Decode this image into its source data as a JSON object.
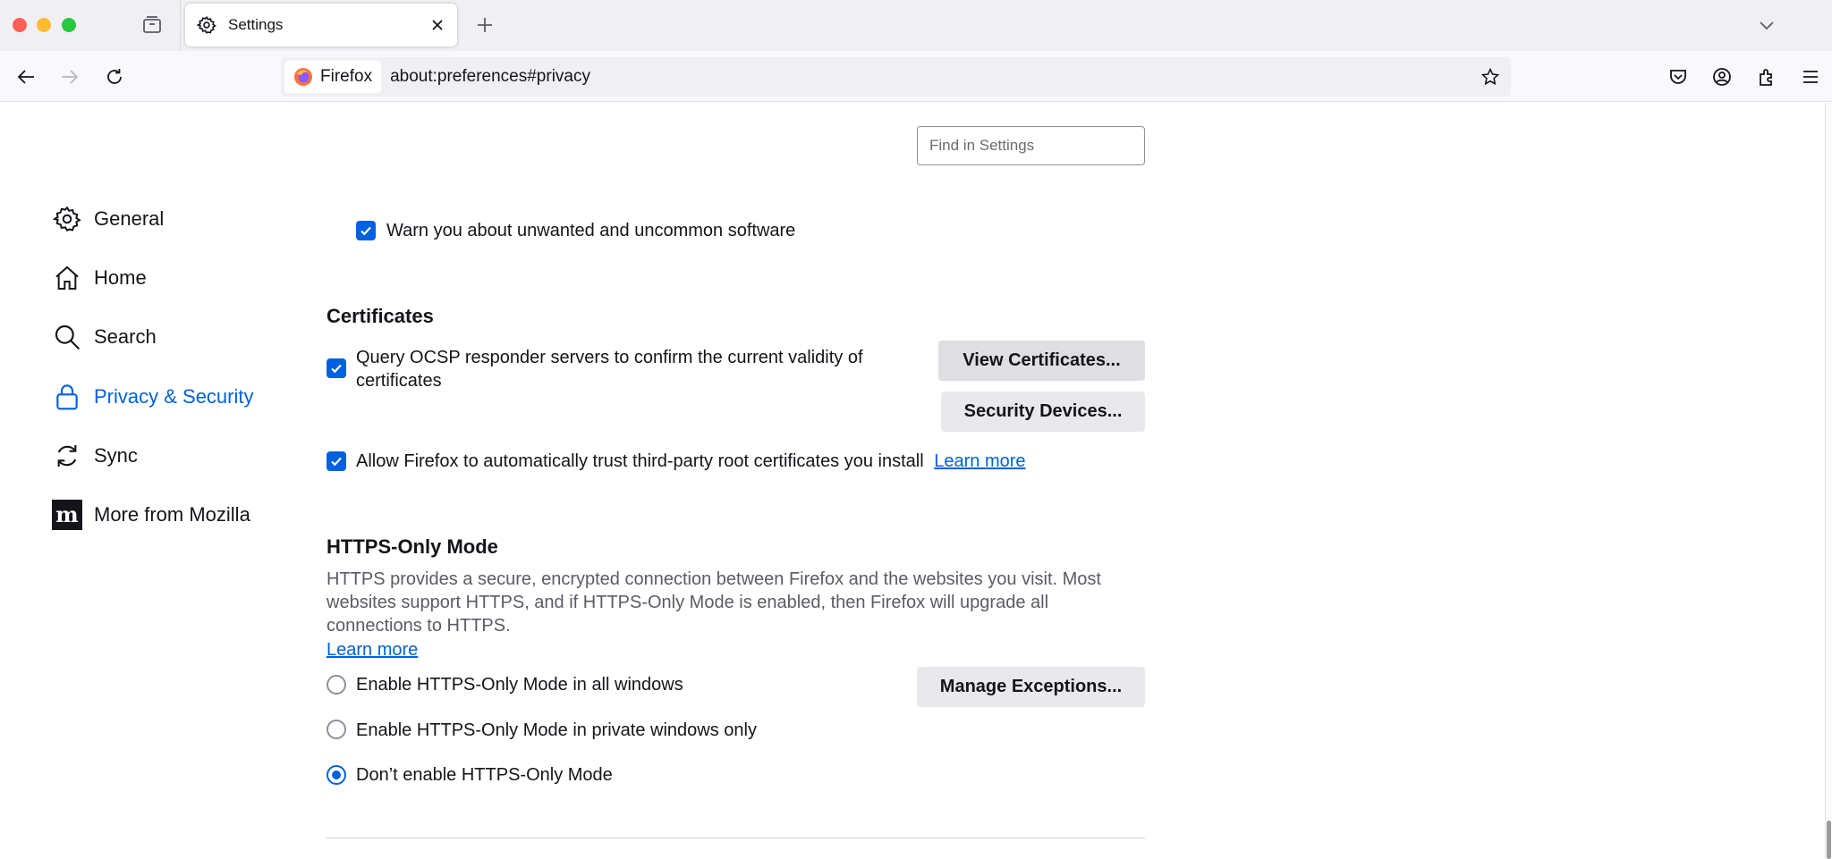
{
  "tab": {
    "title": "Settings"
  },
  "url": {
    "identity": "Firefox",
    "address": "about:preferences#privacy"
  },
  "search": {
    "placeholder": "Find in Settings"
  },
  "sidebar": {
    "items": [
      {
        "label": "General",
        "icon": "gear-icon"
      },
      {
        "label": "Home",
        "icon": "home-icon"
      },
      {
        "label": "Search",
        "icon": "search-icon"
      },
      {
        "label": "Privacy & Security",
        "icon": "lock-icon",
        "selected": true
      },
      {
        "label": "Sync",
        "icon": "sync-icon"
      },
      {
        "label": "More from Mozilla",
        "icon": "mozilla-logo-icon"
      }
    ]
  },
  "privacy": {
    "warn_unwanted_label": "Warn you about unwanted and uncommon software",
    "certificates": {
      "heading": "Certificates",
      "ocsp_label": "Query OCSP responder servers to confirm the current validity of certificates",
      "view_certs_button": "View Certificates...",
      "security_devices_button": "Security Devices...",
      "auto_trust_label": "Allow Firefox to automatically trust third-party root certificates you install",
      "learn_more": "Learn more"
    },
    "https_only": {
      "heading": "HTTPS-Only Mode",
      "description": "HTTPS provides a secure, encrypted connection between Firefox and the websites you visit. Most websites support HTTPS, and if HTTPS-Only Mode is enabled, then Firefox will upgrade all connections to HTTPS.",
      "learn_more": "Learn more",
      "manage_exceptions_button": "Manage Exceptions...",
      "options": [
        {
          "label": "Enable HTTPS-Only Mode in all windows",
          "checked": false
        },
        {
          "label": "Enable HTTPS-Only Mode in private windows only",
          "checked": false
        },
        {
          "label": "Don’t enable HTTPS-Only Mode",
          "checked": true
        }
      ]
    }
  },
  "colors": {
    "accent": "#0061e0",
    "text": "#15141a",
    "secondary_text": "#5b5b66"
  }
}
